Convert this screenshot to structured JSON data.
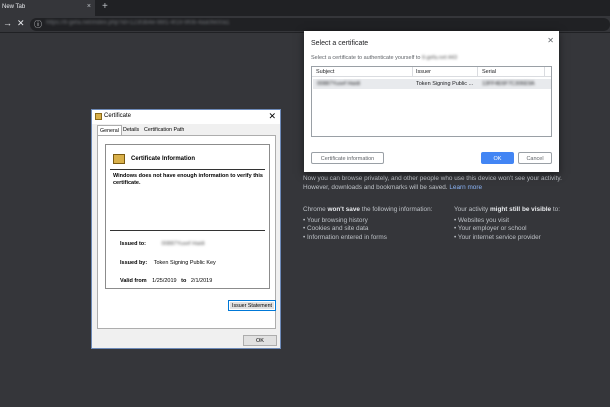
{
  "browser": {
    "tab_title": "New Tab",
    "tab_close": "×",
    "new_tab": "+",
    "back_icon": "→",
    "stop_icon": "✕",
    "info_icon": "ⓘ",
    "url": "https://tl-gefa.net/index.php?id=123f3b4e-9bf1-4f19-9f0b-4aa0fe00a1"
  },
  "incognito": {
    "intro": "Now you can browse privately, and other people who use this device won't see your activity. However, downloads and bookmarks will be saved.",
    "learn_more": "Learn more",
    "left_heading_prefix": "Chrome",
    "left_heading_bold": "won't save",
    "left_heading_suffix": "the following information:",
    "left_items": [
      "Your browsing history",
      "Cookies and site data",
      "Information entered in forms"
    ],
    "right_heading_prefix": "Your activity",
    "right_heading_bold": "might still be visible",
    "right_heading_suffix": "to:",
    "right_items": [
      "Websites you visit",
      "Your employer or school",
      "Your internet service provider"
    ]
  },
  "cert_dialog": {
    "title": "Certificate",
    "close": "✕",
    "tabs": [
      "General",
      "Details",
      "Certification Path"
    ],
    "info_title": "Certificate Information",
    "warning": "Windows does not have enough information to verify this certificate.",
    "issued_to_label": "Issued to:",
    "issued_to_value": "00887Yusef Haidi",
    "issued_by_label": "Issued by:",
    "issued_by_value": "Token Signing Public Key",
    "valid_from_label": "Valid from",
    "valid_from": "1/25/2019",
    "valid_to_label": "to",
    "valid_to": "2/1/2019",
    "issuer_statement": "Issuer Statement",
    "ok": "OK"
  },
  "select_dialog": {
    "title": "Select a certificate",
    "close": "✕",
    "subtitle": "Select a certificate to authenticate yourself to",
    "subtitle_host": "tl-gefa.net:443",
    "columns": [
      "Subject",
      "Issuer",
      "Serial"
    ],
    "rows": [
      {
        "subject": "00887Yusef Haidi",
        "issuer": "Token Signing Public ...",
        "serial": "13FF4E6F7C306E9A"
      }
    ],
    "cert_info_btn": "Certificate information",
    "ok_btn": "OK",
    "cancel_btn": "Cancel"
  },
  "colors": {
    "page_bg": "#35363a",
    "accent_blue": "#4285f4",
    "link": "#8ab4f8"
  }
}
